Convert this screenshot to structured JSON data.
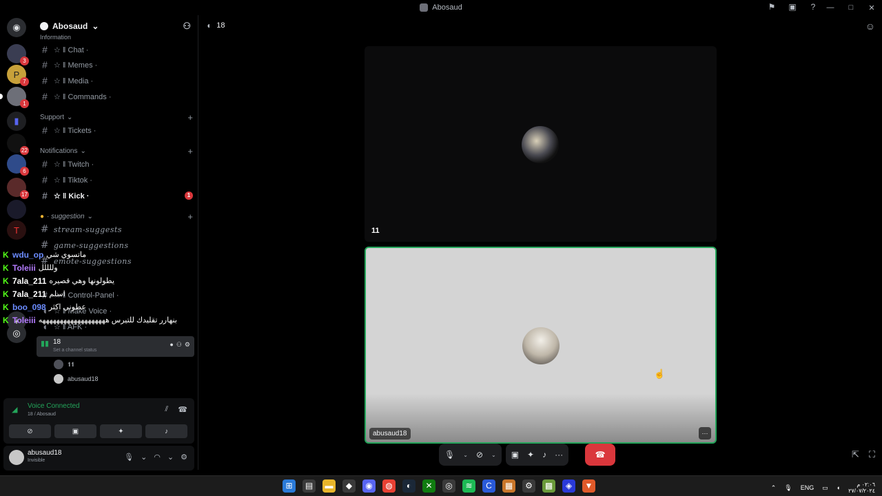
{
  "window": {
    "title": "Abosaud"
  },
  "rail": {
    "badges": [
      "3",
      "7",
      "1",
      "22",
      "6",
      "17"
    ]
  },
  "sidebar": {
    "server_name": "Abosaud",
    "category_top_partial": "Information",
    "channels_info": [
      "☆ ‖ Chat ·",
      "☆ ‖ Memes ·",
      "☆ ‖ Media ·",
      "☆ ‖ Commands ·"
    ],
    "category_support": "Support",
    "channels_support": [
      "☆ ‖ Tickets ·"
    ],
    "category_notifications": "Notifications",
    "channels_notifications": [
      "☆ ‖ Twitch ·",
      "☆ ‖ Tiktok ·",
      "☆ ‖ Kick ·"
    ],
    "kick_badge": "1",
    "category_suggestion": "· suggestion",
    "channels_suggestion": [
      "stream-suggests",
      "game-suggestions",
      "emote-suggestions"
    ],
    "channels_voice": [
      "☆ ‖ Control-Panel ·",
      "☆ ‖ Make Voice ·",
      "☆ ‖ AFK ·"
    ],
    "voice_channel": {
      "name": "18",
      "status": "Set a channel status"
    },
    "members": [
      "𝟏𝟏",
      "abusaud18"
    ]
  },
  "chat_overlay": [
    {
      "user": "wdu_op",
      "color": "#6b8cff",
      "msg": "ماتسوي شي"
    },
    {
      "user": "Toleiii",
      "color": "#b47cff",
      "msg": "وللللل"
    },
    {
      "user": "7ala_211",
      "color": "#ffffff",
      "msg": "يطولونها وهي قصيره"
    },
    {
      "user": "7ala_211",
      "color": "#ffffff",
      "msg": "اسلم"
    },
    {
      "user": "boo_098",
      "color": "#6b8cff",
      "msg": "عطوني اكثر"
    },
    {
      "user": "Toleiii",
      "color": "#b47cff",
      "msg": "بنهارر تقليدك للتيرس هههههههههههههههههههه"
    }
  ],
  "voice_panel": {
    "title": "Voice Connected",
    "subtitle": "18 / Abosaud"
  },
  "user_panel": {
    "username": "abusaud18",
    "status": "Invisible"
  },
  "main": {
    "channel_name": "18",
    "tile1_label": "11",
    "tile2_label": "abusaud18"
  },
  "taskbar": {
    "lang": "ENG",
    "time": "٠٢:٠٦ م",
    "date": "٢٧/٠٧/٢٠٢٤"
  },
  "colors": {
    "accent_green": "#23a55a",
    "danger_red": "#da373c",
    "kick_green": "#53fc18"
  }
}
